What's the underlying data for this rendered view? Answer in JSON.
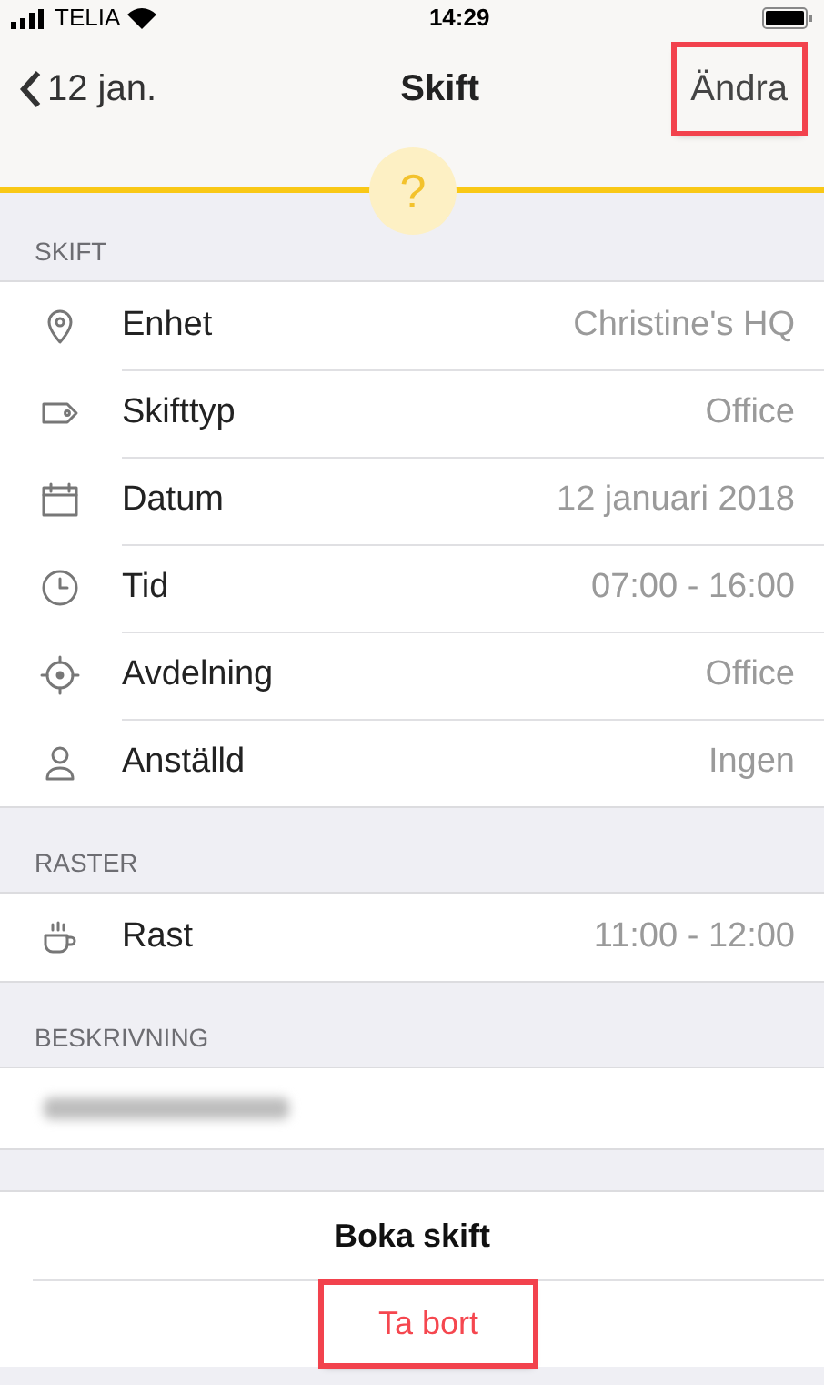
{
  "status_bar": {
    "carrier": "TELIA",
    "time": "14:29"
  },
  "nav": {
    "back": "12 jan.",
    "title": "Skift",
    "action": {
      "label": "Ändra",
      "highlighted": true
    },
    "help": "?"
  },
  "sections": [
    {
      "header": "SKIFT",
      "rows": [
        {
          "kind": "location",
          "label": "Enhet",
          "value": "Christine's HQ"
        },
        {
          "kind": "type",
          "label": "Skifttyp",
          "value": "Office"
        },
        {
          "kind": "date",
          "label": "Datum",
          "value": "12 januari 2018"
        },
        {
          "kind": "time",
          "label": "Tid",
          "value": "07:00 - 16:00"
        },
        {
          "kind": "department",
          "label": "Avdelning",
          "value": "Office"
        },
        {
          "kind": "employee",
          "label": "Anställd",
          "value": "Ingen"
        }
      ]
    },
    {
      "header": "RASTER",
      "rows": [
        {
          "kind": "break",
          "label": "Rast",
          "value": "11:00 - 12:00"
        }
      ]
    },
    {
      "header": "BESKRIVNING",
      "description": {
        "blurred": true
      }
    }
  ],
  "actions": [
    {
      "label": "Boka skift",
      "kind": "primary",
      "highlighted": false
    },
    {
      "label": "Ta bort",
      "kind": "destructive",
      "highlighted": true
    }
  ]
}
